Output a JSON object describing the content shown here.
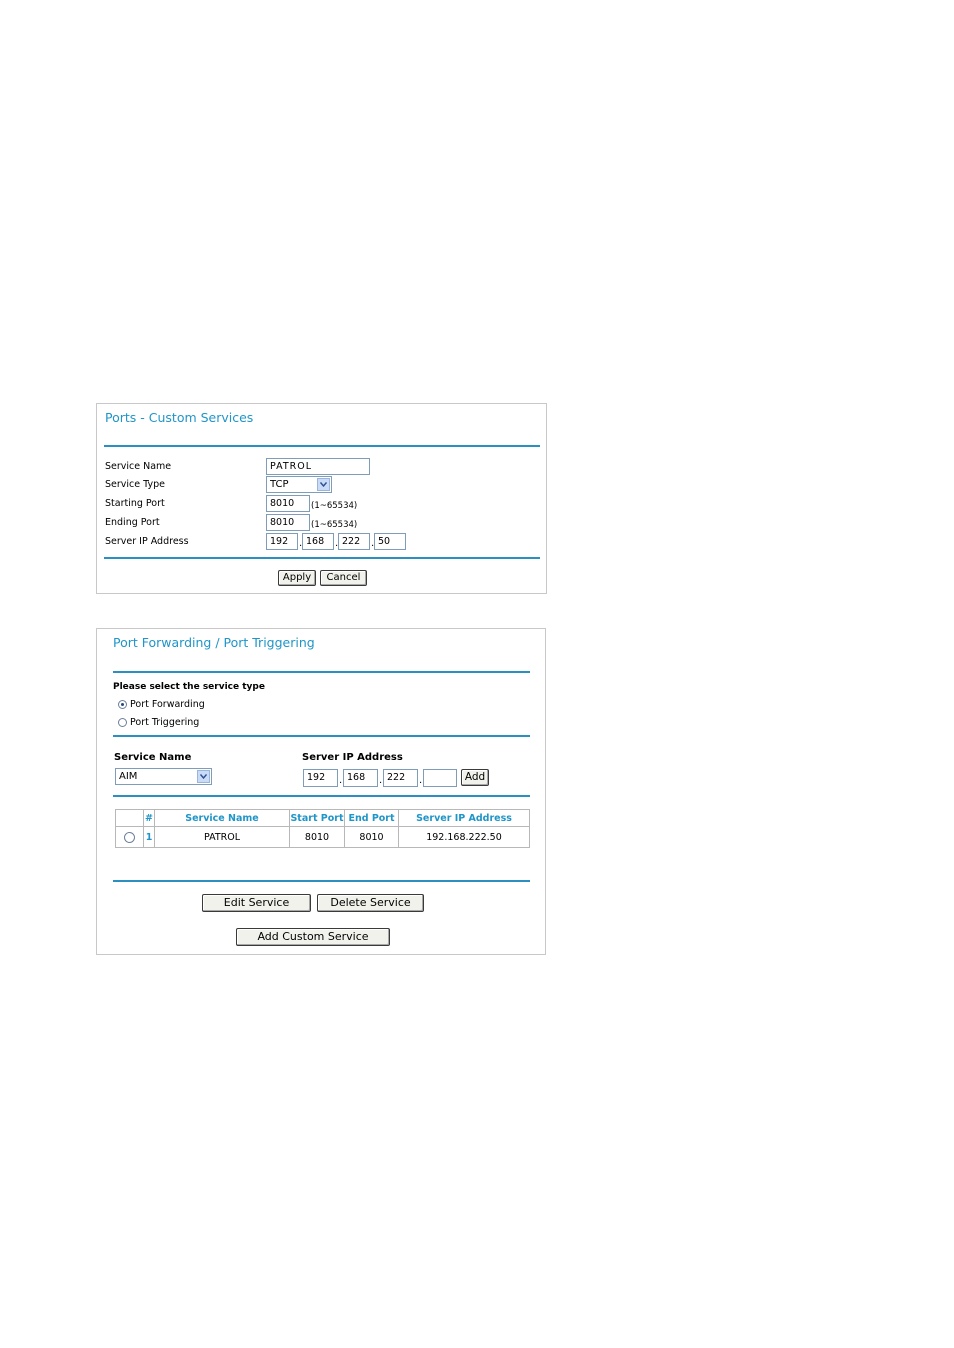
{
  "custom_services": {
    "title": "Ports - Custom Services",
    "service_name_label": "Service Name",
    "service_name_value": "PATROL",
    "service_type_label": "Service Type",
    "service_type_value": "TCP",
    "starting_port_label": "Starting Port",
    "starting_port_value": "8010",
    "starting_port_hint": "(1~65534)",
    "ending_port_label": "Ending Port",
    "ending_port_value": "8010",
    "ending_port_hint": "(1~65534)",
    "server_ip_label": "Server IP Address",
    "server_ip": [
      "192",
      "168",
      "222",
      "50"
    ],
    "apply_label": "Apply",
    "cancel_label": "Cancel"
  },
  "port_forwarding": {
    "title": "Port Forwarding / Port Triggering",
    "select_type_label": "Please select the service type",
    "option_forwarding": "Port Forwarding",
    "option_triggering": "Port Triggering",
    "selected_option": "Port Forwarding",
    "service_name_label": "Service Name",
    "service_name_value": "AIM",
    "server_ip_label": "Server IP Address",
    "server_ip": [
      "192",
      "168",
      "222",
      ""
    ],
    "add_label": "Add",
    "table": {
      "headers": [
        "#",
        "Service Name",
        "Start Port",
        "End Port",
        "Server IP Address"
      ],
      "rows": [
        {
          "num": "1",
          "service_name": "PATROL",
          "start_port": "8010",
          "end_port": "8010",
          "server_ip": "192.168.222.50"
        }
      ]
    },
    "edit_label": "Edit Service",
    "delete_label": "Delete Service",
    "add_custom_label": "Add Custom Service"
  },
  "colors": {
    "accent": "#1f95c8",
    "rule": "#2b8fc0"
  }
}
